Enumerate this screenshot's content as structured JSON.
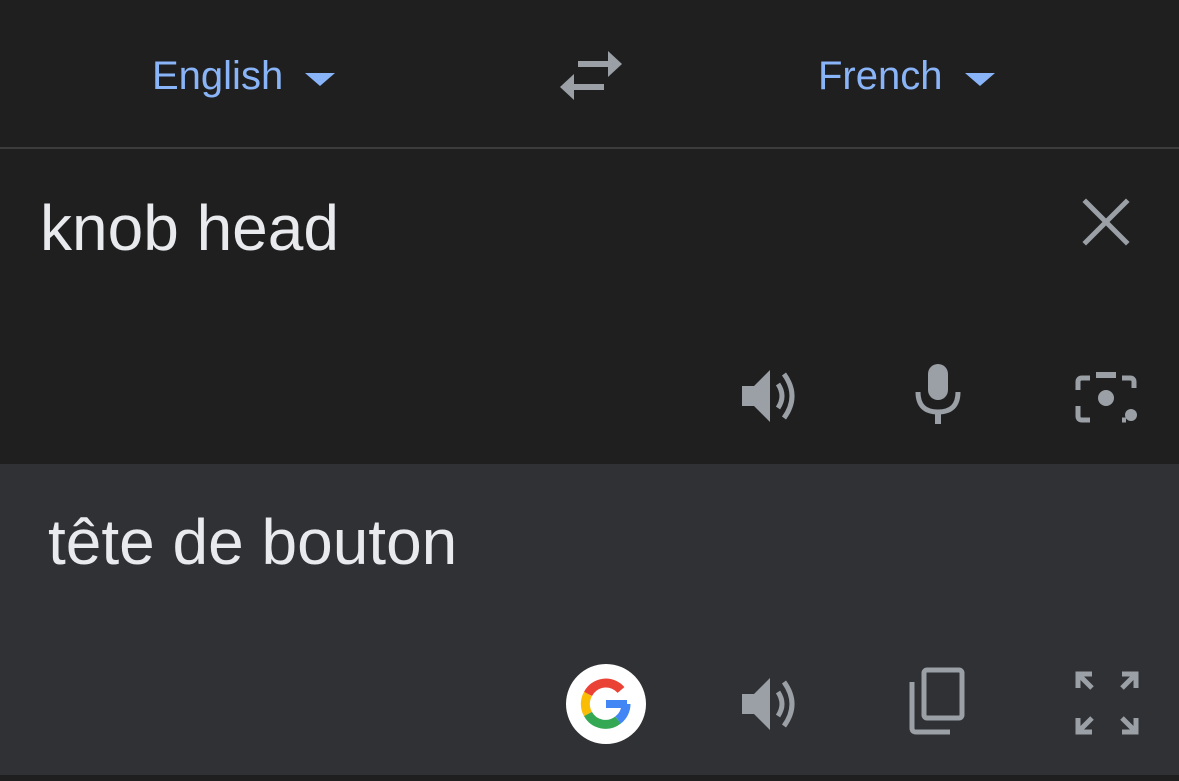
{
  "languages": {
    "source": "English",
    "target": "French"
  },
  "input": {
    "text": "knob head"
  },
  "output": {
    "text": "tête de bouton"
  },
  "icons": {
    "swap": "swap-languages-icon",
    "clear": "close-icon",
    "source_speak": "speaker-icon",
    "mic": "microphone-icon",
    "camera": "camera-icon",
    "google": "google-logo-icon",
    "target_speak": "speaker-icon",
    "copy": "copy-icon",
    "fullscreen": "fullscreen-icon"
  },
  "colors": {
    "accent": "#8ab4f8",
    "background": "#1f1f1f",
    "output_background": "#303134",
    "icon": "#9aa0a6",
    "text": "#e8eaed"
  }
}
